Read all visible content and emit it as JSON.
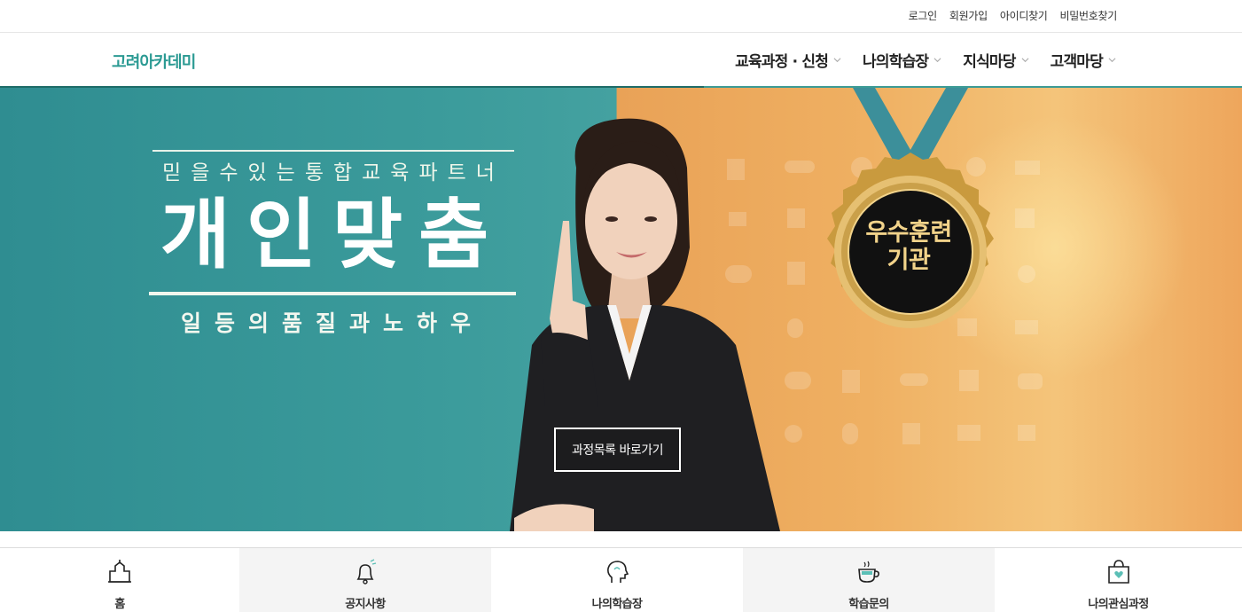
{
  "top_links": [
    "로그인",
    "회원가입",
    "아이디찾기",
    "비밀번호찾기"
  ],
  "logo": "고려아카데미",
  "nav": [
    "교육과정 · 신청",
    "나의학습장",
    "지식마당",
    "고객마당"
  ],
  "hero": {
    "tagline": "믿을수있는통합교육파트너",
    "headline": "개인맞춤",
    "subline": "일등의품질과노하우",
    "medal_line1": "우수훈련",
    "medal_line2": "기관",
    "cta": "과정목록 바로가기"
  },
  "quick_menu": [
    {
      "label": "홈",
      "icon": "home-icon"
    },
    {
      "label": "공지사항",
      "icon": "bell-icon"
    },
    {
      "label": "나의학습장",
      "icon": "head-icon"
    },
    {
      "label": "학습문의",
      "icon": "coffee-cup-icon"
    },
    {
      "label": "나의관심과정",
      "icon": "shopping-bag-heart-icon"
    }
  ],
  "colors": {
    "brand": "#2b9a93",
    "hero_left": "#3b9b9b",
    "hero_right": "#efb062",
    "medal_gold": "#c99a3e"
  }
}
